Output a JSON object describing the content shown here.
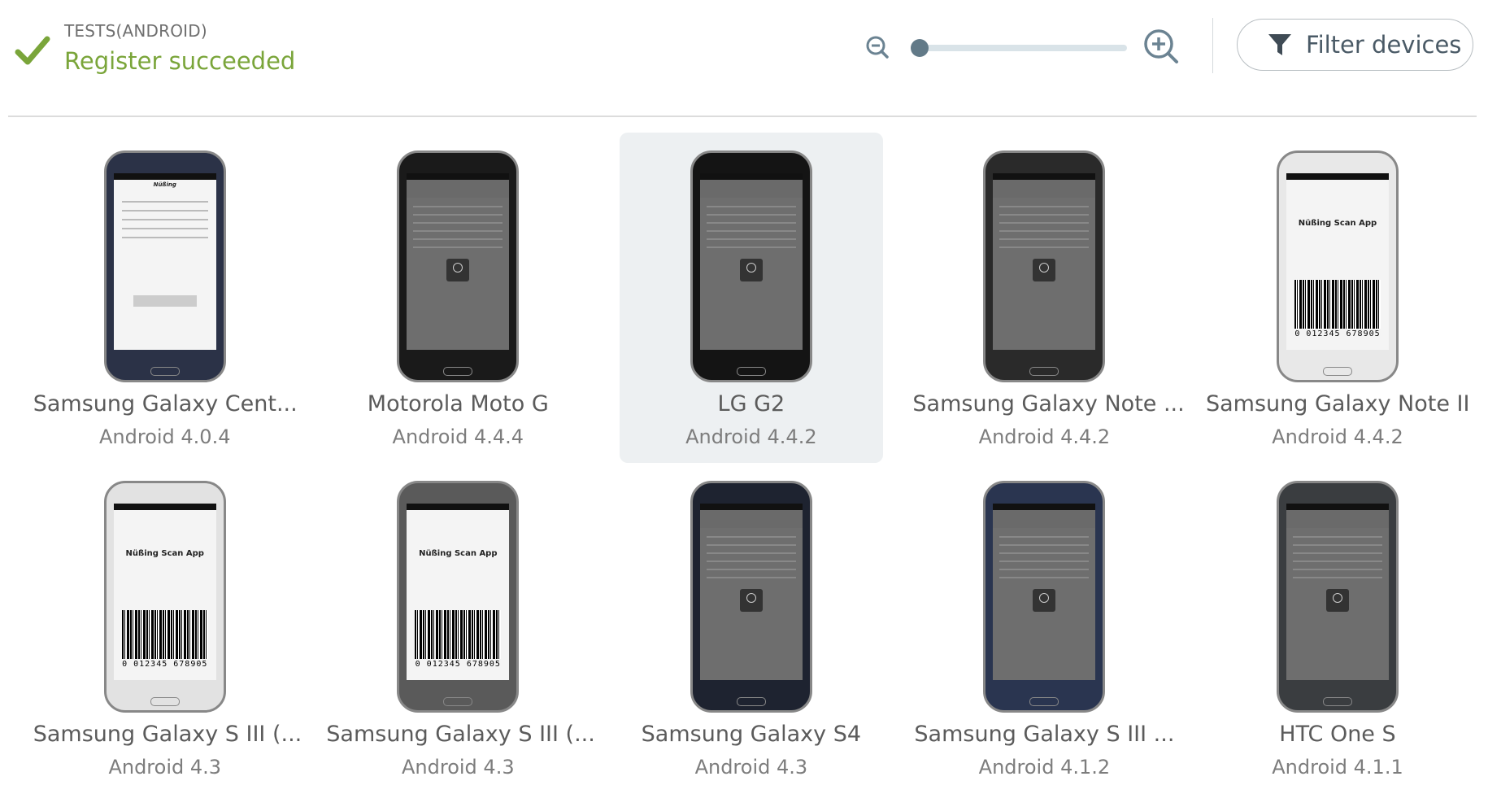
{
  "header": {
    "suite_title": "TESTS(ANDROID)",
    "status_text": "Register succeeded",
    "status_color": "#7aa53a",
    "status_icon": "check-icon",
    "zoom_level": 0.0,
    "filter_label": "Filter devices",
    "filter_icon": "funnel-icon",
    "zoom_out_icon": "zoom-out-icon",
    "zoom_in_icon": "zoom-in-icon"
  },
  "devices": [
    {
      "name": "Samsung Galaxy Cent...",
      "os": "Android 4.0.4",
      "selected": false,
      "style": "form-white",
      "color": "#2b3247"
    },
    {
      "name": "Motorola Moto G",
      "os": "Android 4.4.4",
      "selected": false,
      "style": "loading",
      "color": "#1a1a1a"
    },
    {
      "name": "LG G2",
      "os": "Android 4.4.2",
      "selected": true,
      "style": "loading",
      "color": "#141414"
    },
    {
      "name": "Samsung Galaxy Note ...",
      "os": "Android 4.4.2",
      "selected": false,
      "style": "loading",
      "color": "#2a2a2a"
    },
    {
      "name": "Samsung Galaxy Note II",
      "os": "Android 4.4.2",
      "selected": false,
      "style": "barcode",
      "color": "#e8e8e8"
    },
    {
      "name": "Samsung Galaxy S III (...",
      "os": "Android 4.3",
      "selected": false,
      "style": "barcode",
      "color": "#e2e2e2"
    },
    {
      "name": "Samsung Galaxy S III (...",
      "os": "Android 4.3",
      "selected": false,
      "style": "barcode",
      "color": "#5a5a5a"
    },
    {
      "name": "Samsung Galaxy S4",
      "os": "Android 4.3",
      "selected": false,
      "style": "loading",
      "color": "#1e2330"
    },
    {
      "name": "Samsung Galaxy S III ...",
      "os": "Android 4.1.2",
      "selected": false,
      "style": "loading",
      "color": "#2a3550"
    },
    {
      "name": "HTC One S",
      "os": "Android 4.1.1",
      "selected": false,
      "style": "loading",
      "color": "#3a3d40"
    }
  ],
  "screen_content": {
    "app_name": "Nüßing Scan App",
    "barcode_number": "0 012345 678905",
    "logo": "Nüßing"
  }
}
